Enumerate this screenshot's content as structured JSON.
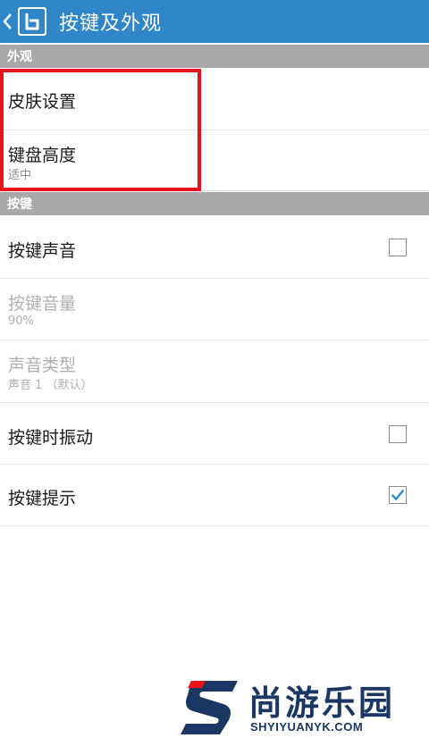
{
  "appbar": {
    "title": "按键及外观"
  },
  "sections": {
    "appearance": "外观",
    "keys": "按键"
  },
  "appearance_items": {
    "skin": {
      "title": "皮肤设置"
    },
    "keyboard_height": {
      "title": "键盘高度",
      "value": "适中"
    }
  },
  "key_items": {
    "key_sound": {
      "title": "按键声音",
      "checked": false
    },
    "key_volume": {
      "title": "按键音量",
      "value": "90%"
    },
    "sound_type": {
      "title": "声音类型",
      "value": "声音 1 （默认）"
    },
    "key_vibrate": {
      "title": "按键时振动",
      "checked": false
    },
    "key_hint": {
      "title": "按键提示",
      "checked": true
    }
  },
  "watermark": {
    "cn": "尚游乐园",
    "en": "SHYIYUANYK.COM"
  },
  "colors": {
    "appbar": "#2f86c9",
    "section_header": "#a9a9a9",
    "highlight": "#e8121b",
    "check": "#2f86c9",
    "watermark_blue": "#1a3763",
    "watermark_red": "#e8121b"
  }
}
